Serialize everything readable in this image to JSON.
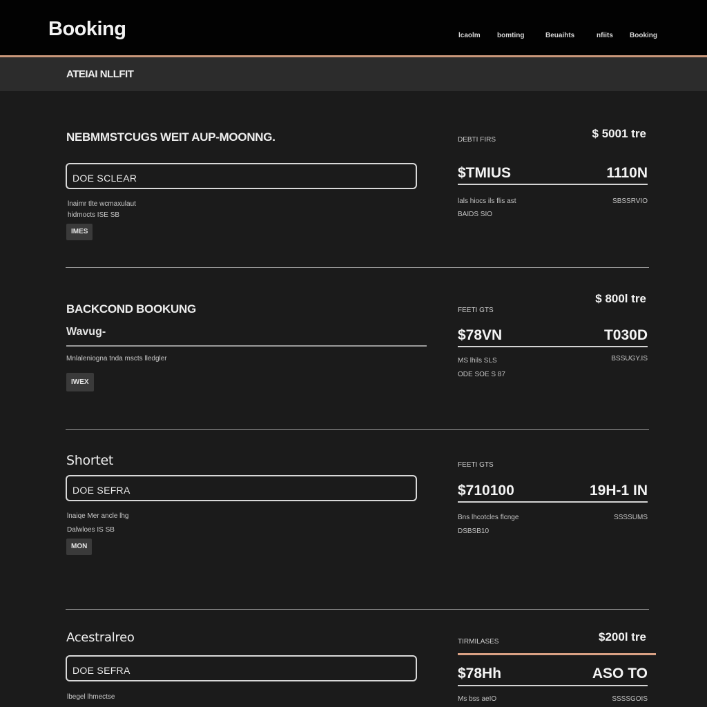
{
  "header": {
    "brand": "Booking",
    "nav": [
      "lcaolm",
      "bomting",
      "Beuaihts",
      "nfiits",
      "Booking"
    ]
  },
  "subheader": {
    "title": "ATEIAI NLLFIT"
  },
  "sections": [
    {
      "title": "NEBMMSTCUGS WEIT AUP-MOONNG.",
      "field_value": "DOE SCLEAR",
      "note_line1": "lnaimr tlte wcmaxulaut",
      "note_line2": "hidmocts ISE SB",
      "tag": "IMES",
      "right_label": "DEBTI FIRS",
      "price": "$ 5001 tre",
      "big_left": "$TMIUS",
      "big_right": "1110N",
      "small_left_1": "lals hiocs ils flis ast",
      "small_left_2": "BAIDS SIO",
      "small_right": "SBSSRVIO"
    },
    {
      "title": "BACKCOND BOOKUNG",
      "field_value": "Wavug-",
      "note_line1": "Mnlaleniogna tnda mscts lledgler",
      "tag": "IWEX",
      "right_label": "FEETI GTS",
      "price": "$ 800l tre",
      "big_left": "$78VN",
      "big_right": "T030D",
      "small_left_1": "MS lhils SLS",
      "small_left_2": "ODE SOE S 87",
      "small_right": "BSSUGY.IS"
    },
    {
      "title": "Shortet",
      "field_value": "DOE SEFRA",
      "note_line1": "lnaiqe Mer ancle lhg",
      "note_line2": "Dalwloes IS SB",
      "tag": "MON",
      "right_label": "FEETI GTS",
      "big_left": "$710100",
      "big_right": "19H-1 IN",
      "small_left_1": "Bns lhcotcles flcnge",
      "small_left_2": "DSBSB10",
      "small_right": "SSSSUMS"
    },
    {
      "title": "Acestralreo",
      "field_value": "DOE SEFRA",
      "note_line1": "lbegel lhmectse",
      "right_label": "TIRMILASES",
      "price": "$200l tre",
      "big_left": "$78Hh",
      "big_right": "ASO TO",
      "small_left_1": "Ms bss aeIO",
      "small_right": "SSSSGOIS"
    }
  ]
}
